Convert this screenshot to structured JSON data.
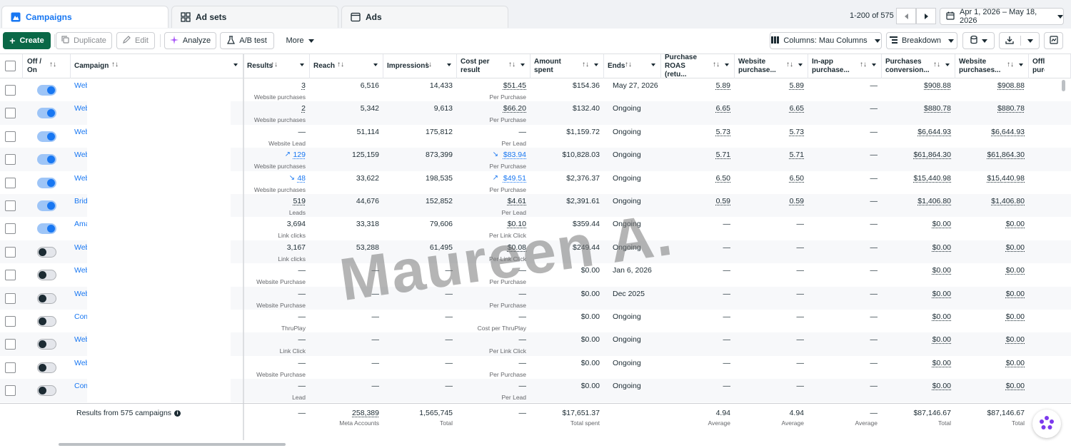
{
  "tabs": [
    {
      "label": "Campaigns",
      "icon": "campaigns-icon"
    },
    {
      "label": "Ad sets",
      "icon": "grid-icon"
    },
    {
      "label": "Ads",
      "icon": "ad-icon"
    }
  ],
  "pagination": {
    "range": "1-200 of 575"
  },
  "date_range": "Apr 1, 2026 – May 18, 2026",
  "toolbar": {
    "create": "Create",
    "duplicate": "Duplicate",
    "edit": "Edit",
    "analyze": "Analyze",
    "ab_test": "A/B test",
    "more": "More",
    "columns": "Columns: Mau Columns",
    "breakdown": "Breakdown"
  },
  "columns": [
    {
      "key": "toggle",
      "label": "Off / On"
    },
    {
      "key": "campaign",
      "label": "Campaign"
    },
    {
      "key": "results",
      "label": "Results"
    },
    {
      "key": "reach",
      "label": "Reach"
    },
    {
      "key": "impressions",
      "label": "Impressions"
    },
    {
      "key": "cpr",
      "label": "Cost per result"
    },
    {
      "key": "spent",
      "label": "Amount spent"
    },
    {
      "key": "ends",
      "label": "Ends"
    },
    {
      "key": "roas",
      "label": "Purchase ROAS (retu..."
    },
    {
      "key": "wroas",
      "label": "Website purchase..."
    },
    {
      "key": "inapp",
      "label": "In-app purchase..."
    },
    {
      "key": "pconv",
      "label": "Purchases conversion..."
    },
    {
      "key": "wpurch",
      "label": "Website purchases..."
    },
    {
      "key": "offline",
      "label": "Offline purchases"
    }
  ],
  "rows": [
    {
      "on": true,
      "name": "Web",
      "results": "3",
      "results_sub": "Website purchases",
      "results_trend": "",
      "reach": "6,516",
      "impressions": "14,433",
      "cpr": "$51.45",
      "cpr_sub": "Per Purchase",
      "cpr_trend": "",
      "spent": "$154.36",
      "ends": "May 27, 2026",
      "roas": "5.89",
      "wroas": "5.89",
      "inapp": "—",
      "pconv": "$908.88",
      "wpurch": "$908.88"
    },
    {
      "on": true,
      "name": "Web",
      "results": "2",
      "results_sub": "Website purchases",
      "results_trend": "",
      "reach": "5,342",
      "impressions": "9,613",
      "cpr": "$66.20",
      "cpr_sub": "Per Purchase",
      "cpr_trend": "",
      "spent": "$132.40",
      "ends": "Ongoing",
      "roas": "6.65",
      "wroas": "6.65",
      "inapp": "—",
      "pconv": "$880.78",
      "wpurch": "$880.78"
    },
    {
      "on": true,
      "name": "Web",
      "results": "—",
      "results_sub": "Website Lead",
      "results_trend": "",
      "reach": "51,114",
      "impressions": "175,812",
      "cpr": "—",
      "cpr_sub": "Per Lead",
      "cpr_trend": "",
      "spent": "$1,159.72",
      "ends": "Ongoing",
      "roas": "5.73",
      "wroas": "5.73",
      "inapp": "—",
      "pconv": "$6,644.93",
      "wpurch": "$6,644.93"
    },
    {
      "on": true,
      "name": "Web",
      "results": "129",
      "results_sub": "Website purchases",
      "results_trend": "up",
      "reach": "125,159",
      "impressions": "873,399",
      "cpr": "$83.94",
      "cpr_sub": "Per Purchase",
      "cpr_trend": "down",
      "spent": "$10,828.03",
      "ends": "Ongoing",
      "roas": "5.71",
      "wroas": "5.71",
      "inapp": "—",
      "pconv": "$61,864.30",
      "wpurch": "$61,864.30"
    },
    {
      "on": true,
      "name": "Web",
      "results": "48",
      "results_sub": "Website purchases",
      "results_trend": "down",
      "reach": "33,622",
      "impressions": "198,535",
      "cpr": "$49.51",
      "cpr_sub": "Per Purchase",
      "cpr_trend": "up",
      "spent": "$2,376.37",
      "ends": "Ongoing",
      "roas": "6.50",
      "wroas": "6.50",
      "inapp": "—",
      "pconv": "$15,440.98",
      "wpurch": "$15,440.98"
    },
    {
      "on": true,
      "name": "Brid",
      "results": "519",
      "results_sub": "Leads",
      "results_trend": "",
      "reach": "44,676",
      "impressions": "152,852",
      "cpr": "$4.61",
      "cpr_sub": "Per Lead",
      "cpr_trend": "",
      "spent": "$2,391.61",
      "ends": "Ongoing",
      "roas": "0.59",
      "wroas": "0.59",
      "inapp": "—",
      "pconv": "$1,406.80",
      "wpurch": "$1,406.80"
    },
    {
      "on": true,
      "name": "Ama",
      "results": "3,694",
      "results_sub": "Link clicks",
      "results_trend": "",
      "reach": "33,318",
      "impressions": "79,606",
      "cpr": "$0.10",
      "cpr_sub": "Per Link Click",
      "cpr_trend": "",
      "spent": "$359.44",
      "ends": "Ongoing",
      "roas": "—",
      "wroas": "—",
      "inapp": "—",
      "pconv": "$0.00",
      "wpurch": "$0.00"
    },
    {
      "on": false,
      "name": "Web",
      "results": "3,167",
      "results_sub": "Link clicks",
      "results_trend": "",
      "reach": "53,288",
      "impressions": "61,495",
      "cpr": "$0.08",
      "cpr_sub": "Per Link Click",
      "cpr_trend": "",
      "spent": "$249.44",
      "ends": "Ongoing",
      "roas": "—",
      "wroas": "—",
      "inapp": "—",
      "pconv": "$0.00",
      "wpurch": "$0.00"
    },
    {
      "on": false,
      "name": "Web",
      "results": "—",
      "results_sub": "Website Purchase",
      "results_trend": "",
      "reach": "—",
      "impressions": "—",
      "cpr": "—",
      "cpr_sub": "Per Purchase",
      "cpr_trend": "",
      "spent": "$0.00",
      "ends": "Jan 6, 2026",
      "roas": "—",
      "wroas": "—",
      "inapp": "—",
      "pconv": "$0.00",
      "wpurch": "$0.00"
    },
    {
      "on": false,
      "name": "Web",
      "results": "—",
      "results_sub": "Website Purchase",
      "results_trend": "",
      "reach": "—",
      "impressions": "—",
      "cpr": "—",
      "cpr_sub": "Per Purchase",
      "cpr_trend": "",
      "spent": "$0.00",
      "ends": "Dec 2025",
      "roas": "—",
      "wroas": "—",
      "inapp": "—",
      "pconv": "$0.00",
      "wpurch": "$0.00"
    },
    {
      "on": false,
      "name": "Com",
      "results": "—",
      "results_sub": "ThruPlay",
      "results_trend": "",
      "reach": "—",
      "impressions": "—",
      "cpr": "—",
      "cpr_sub": "Cost per ThruPlay",
      "cpr_trend": "",
      "spent": "$0.00",
      "ends": "Ongoing",
      "roas": "—",
      "wroas": "—",
      "inapp": "—",
      "pconv": "$0.00",
      "wpurch": "$0.00"
    },
    {
      "on": false,
      "name": "Web",
      "results": "—",
      "results_sub": "Link Click",
      "results_trend": "",
      "reach": "—",
      "impressions": "—",
      "cpr": "—",
      "cpr_sub": "Per Link Click",
      "cpr_trend": "",
      "spent": "$0.00",
      "ends": "Ongoing",
      "roas": "—",
      "wroas": "—",
      "inapp": "—",
      "pconv": "$0.00",
      "wpurch": "$0.00"
    },
    {
      "on": false,
      "name": "Web",
      "results": "—",
      "results_sub": "Website Purchase",
      "results_trend": "",
      "reach": "—",
      "impressions": "—",
      "cpr": "—",
      "cpr_sub": "Per Purchase",
      "cpr_trend": "",
      "spent": "$0.00",
      "ends": "Ongoing",
      "roas": "—",
      "wroas": "—",
      "inapp": "—",
      "pconv": "$0.00",
      "wpurch": "$0.00"
    },
    {
      "on": false,
      "name": "Com",
      "results": "—",
      "results_sub": "Lead",
      "results_trend": "",
      "reach": "—",
      "impressions": "—",
      "cpr": "—",
      "cpr_sub": "Per Lead",
      "cpr_trend": "",
      "spent": "$0.00",
      "ends": "Ongoing",
      "roas": "—",
      "wroas": "—",
      "inapp": "—",
      "pconv": "$0.00",
      "wpurch": "$0.00"
    }
  ],
  "totals": {
    "label": "Results from 575 campaigns",
    "results": "—",
    "reach": "258,389",
    "reach_sub": "Meta Accounts",
    "impressions": "1,565,745",
    "impressions_sub": "Total",
    "cpr": "—",
    "spent": "$17,651.37",
    "spent_sub": "Total spent",
    "roas": "4.94",
    "roas_sub": "Average",
    "wroas": "4.94",
    "wroas_sub": "Average",
    "inapp": "—",
    "inapp_sub": "Average",
    "pconv": "$87,146.67",
    "pconv_sub": "Total",
    "wpurch": "$87,146.67",
    "wpurch_sub": "Total"
  },
  "watermark": "Maureen A.",
  "colors": {
    "accent": "#1877f2",
    "create": "#0a6847"
  }
}
